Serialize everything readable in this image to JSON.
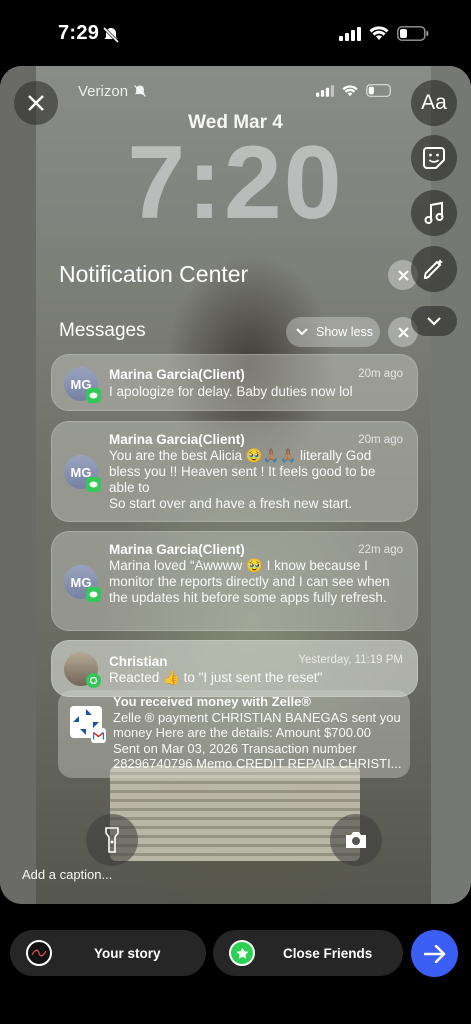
{
  "status_bar": {
    "time": "7:29"
  },
  "lockscreen": {
    "carrier": "Verizon",
    "date": "Wed Mar 4",
    "time": "7:20"
  },
  "notification_center": {
    "title": "Notification Center",
    "group_title": "Messages",
    "show_less_label": "Show less",
    "notifications": [
      {
        "initials": "MG",
        "sender": "Marina  Garcia(Client)",
        "time": "20m ago",
        "body": [
          "I apologize for delay. Baby duties now lol"
        ]
      },
      {
        "initials": "MG",
        "sender": "Marina  Garcia(Client)",
        "time": "20m ago",
        "body": [
          "You are the best Alicia 🥹🙏🏽🙏🏽 literally God",
          "bless you !! Heaven sent ! It feels good to be",
          "able to",
          "So start over and have a fresh new start."
        ]
      },
      {
        "initials": "MG",
        "sender": "Marina  Garcia(Client)",
        "time": "22m ago",
        "body": [
          "Marina  loved “Awwww 🥹 I know because I",
          "monitor the reports directly and I can see when",
          "the updates hit before some apps fully refresh."
        ]
      },
      {
        "sender": "Christian",
        "time": "Yesterday, 11:19 PM",
        "body": [
          "Reacted 👍 to \"I just sent the reset\""
        ]
      }
    ],
    "zelle": {
      "lines": [
        "You received money with Zelle®",
        "Zelle ® payment CHRISTIAN BANEGAS sent you",
        "money Here are the details: Amount $700.00",
        "Sent on Mar 03, 2026 Transaction number",
        "28296740796 Memo CREDIT REPAIR CHRISTI..."
      ]
    }
  },
  "editor": {
    "text_tool_label": "Aa",
    "caption_placeholder": "Add a caption...",
    "tools": [
      "close-icon",
      "sticker-icon",
      "music-icon",
      "draw-icon",
      "chevron-down-icon",
      "flashlight-icon",
      "camera-icon"
    ]
  },
  "bottom_bar": {
    "your_story_label": "Your story",
    "close_friends_label": "Close Friends",
    "send_icon": "arrow-right-icon",
    "colors": {
      "send": "#3b5ef5",
      "close_friends": "#2bd152"
    }
  }
}
